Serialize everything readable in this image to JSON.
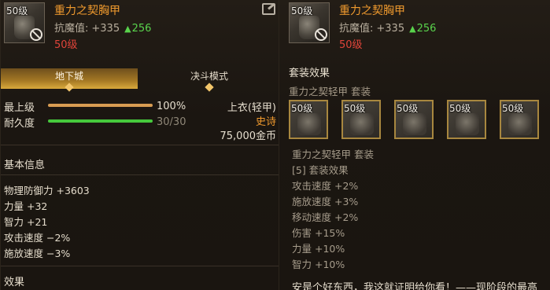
{
  "left_panel": {
    "item": {
      "level_badge": "50级",
      "name": "重力之契胸甲",
      "resist_label": "抗魔值:",
      "resist_value": "+335",
      "resist_bonus": "256",
      "requirement": "50级",
      "icon": "share-icon"
    },
    "tabs": [
      {
        "label": "地下城",
        "active": true
      },
      {
        "label": "决斗模式",
        "active": false
      }
    ],
    "stats": [
      {
        "label": "最上级",
        "percent_text": "100%",
        "fill": 1.0,
        "color": "#d89c52"
      },
      {
        "label": "耐久度",
        "value_text": "30/30",
        "fill": 1.0,
        "color": "#46c83c"
      }
    ],
    "type": {
      "slot": "上衣(轻甲)",
      "rarity": "史诗",
      "price": "75,000金币"
    },
    "basic_info": {
      "title": "基本信息",
      "lines": [
        "物理防御力 +3603",
        "力量 +32",
        "智力 +21",
        "攻击速度 −2%",
        "施放速度 −3%"
      ]
    },
    "effect_title": "效果"
  },
  "right_panel": {
    "item": {
      "level_badge": "50级",
      "name": "重力之契胸甲",
      "resist_label": "抗魔值:",
      "resist_value": "+335",
      "resist_bonus": "256",
      "requirement": "50级"
    },
    "set_title": "套装效果",
    "set_name_line": "重力之契轻甲 套装",
    "slots": [
      "50级",
      "50级",
      "50级",
      "50级",
      "50级"
    ],
    "set_lines": [
      "重力之契轻甲 套装",
      "[5] 套装效果",
      "攻击速度 +2%",
      "施放速度 +3%",
      "移动速度 +2%",
      "伤害 +15%",
      "力量 +10%",
      "智力 +10%"
    ],
    "bottom_text": "安是个好东西，我这就证明给你看！——现阶段的最高"
  },
  "colors": {
    "item_name": "#f09a2e",
    "requirement": "#e0443a",
    "bonus": "#59d34c",
    "rarity": "#f09a2e",
    "active_tab": "#d9a93c"
  }
}
